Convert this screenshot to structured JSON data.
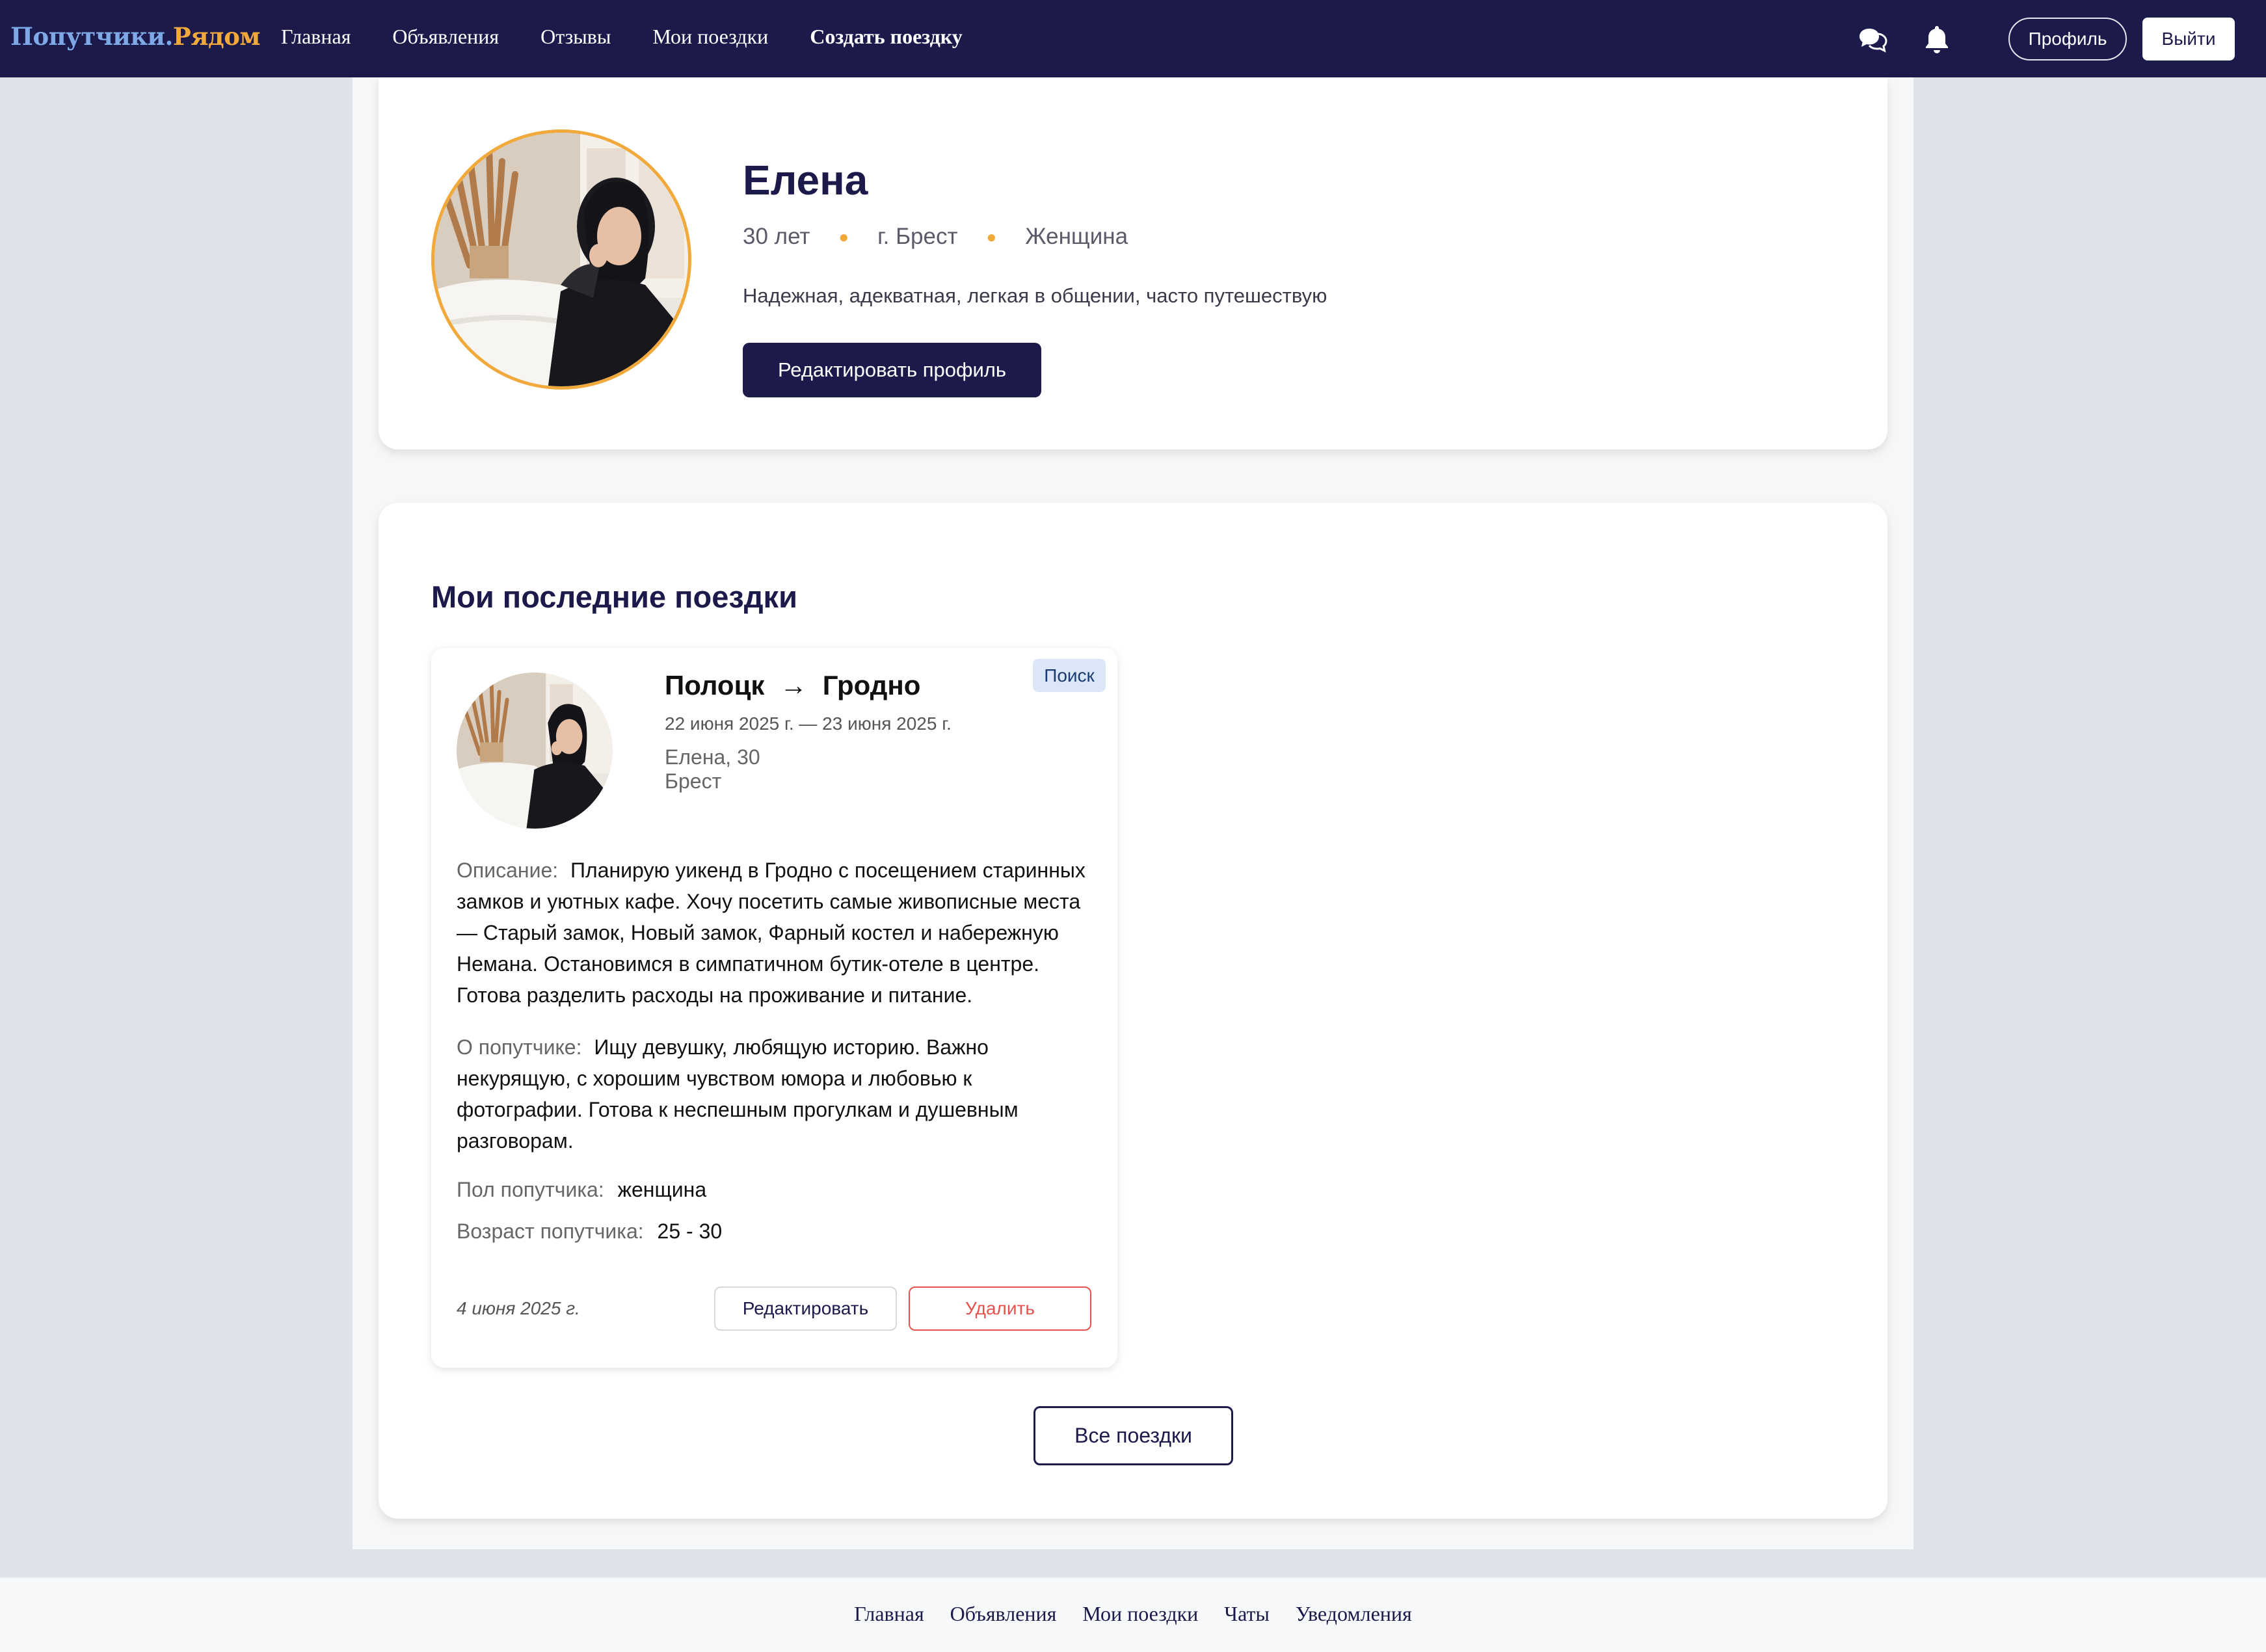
{
  "header": {
    "logo_part1": "Попутчики.",
    "logo_part2": "Рядом",
    "nav": [
      "Главная",
      "Объявления",
      "Отзывы",
      "Мои поездки",
      "Создать поездку"
    ],
    "icons": [
      "chat-icon",
      "bell-icon"
    ],
    "profile_button": "Профиль",
    "logout_button": "Выйти"
  },
  "profile": {
    "name": "Елена",
    "age": "30 лет",
    "city": "г. Брест",
    "gender": "Женщина",
    "bio": "Надежная, адекватная, легкая в общении, часто путешествую",
    "edit_button": "Редактировать профиль"
  },
  "trips_section": {
    "title": "Мои последние поездки",
    "all_button": "Все поездки"
  },
  "trip": {
    "from": "Полоцк",
    "arrow": "→",
    "to": "Гродно",
    "dates": "22 июня 2025 г. — 23 июня 2025 г.",
    "person": "Елена, 30",
    "city": "Брест",
    "status": "Поиск",
    "description_label": "Описание:",
    "description": "Планирую уикенд в Гродно с посещением старинных замков и уютных кафе. Хочу посетить самые живописные места — Старый замок, Новый замок, Фарный костел и набережную Немана. Остановимся в симпатичном бутик-отеле в центре. Готова разделить расходы на проживание и питание.",
    "companion_label": "О попутчике:",
    "companion": "Ищу девушку, любящую историю. Важно некурящую, с хорошим чувством юмора и любовью к фотографии. Готова к неспешным прогулкам и душевным разговорам.",
    "companion_gender_label": "Пол попутчика:",
    "companion_gender": "женщина",
    "companion_age_label": "Возраст попутчика:",
    "companion_age": "25 - 30",
    "created": "4 июня 2025 г.",
    "edit_button": "Редактировать",
    "delete_button": "Удалить"
  },
  "footer": {
    "links": [
      "Главная",
      "Объявления",
      "Мои поездки",
      "Чаты",
      "Уведомления"
    ]
  },
  "colors": {
    "brand": "#1c1a4b",
    "accent": "#f0a93a",
    "danger": "#e8524e"
  }
}
